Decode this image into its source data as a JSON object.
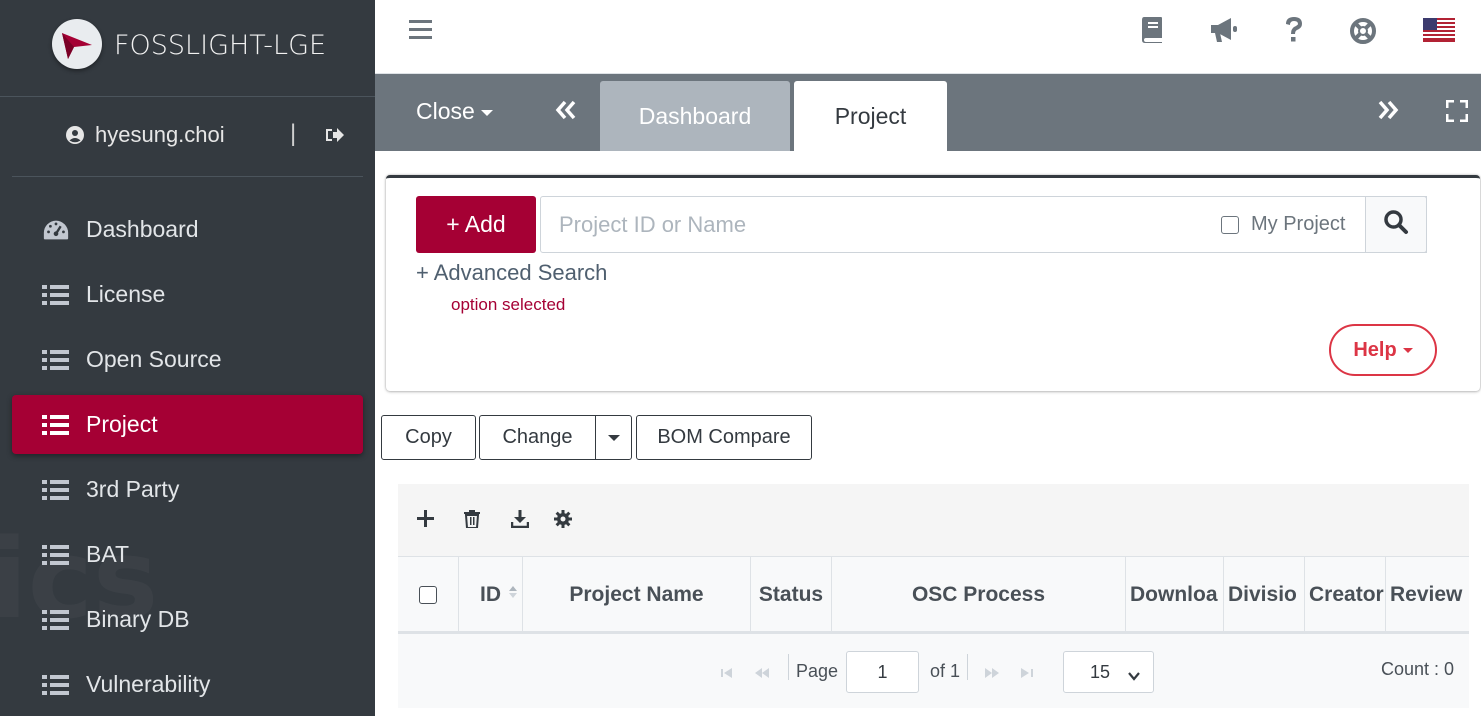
{
  "app": {
    "brand": "FOSSLIGHT-LGE"
  },
  "user": {
    "name": "hyesung.choi",
    "separator": "|"
  },
  "sidebar": {
    "items": [
      {
        "label": "Dashboard",
        "icon": "tachometer-icon"
      },
      {
        "label": "License",
        "icon": "list-icon"
      },
      {
        "label": "Open Source",
        "icon": "list-icon"
      },
      {
        "label": "Project",
        "icon": "list-icon",
        "active": true
      },
      {
        "label": "3rd Party",
        "icon": "list-icon"
      },
      {
        "label": "BAT",
        "icon": "list-icon"
      },
      {
        "label": "Binary DB",
        "icon": "list-icon"
      },
      {
        "label": "Vulnerability",
        "icon": "list-icon"
      }
    ]
  },
  "tabs": {
    "close_label": "Close",
    "items": [
      {
        "label": "Dashboard",
        "active": false
      },
      {
        "label": "Project",
        "active": true
      }
    ]
  },
  "search": {
    "add_label": "+ Add",
    "placeholder": "Project ID or Name",
    "my_project_label": "My Project",
    "advanced_label": "+ Advanced Search",
    "option_selected": "option selected",
    "help_label": "Help"
  },
  "actions": {
    "copy": "Copy",
    "change": "Change",
    "bom_compare": "BOM Compare"
  },
  "grid": {
    "columns": [
      "ID",
      "Project Name",
      "Status",
      "OSC Process",
      "Downloa",
      "Divisio",
      "Creator",
      "Review"
    ],
    "rows": []
  },
  "pagination": {
    "page_label": "Page",
    "page_value": "1",
    "of_label": "of 1",
    "per_page": "15",
    "count_label": "Count : 0"
  },
  "colors": {
    "brand": "#a50034",
    "sidebar_bg": "#343a40",
    "tabbar_bg": "#6c757d",
    "help": "#dc3545"
  }
}
